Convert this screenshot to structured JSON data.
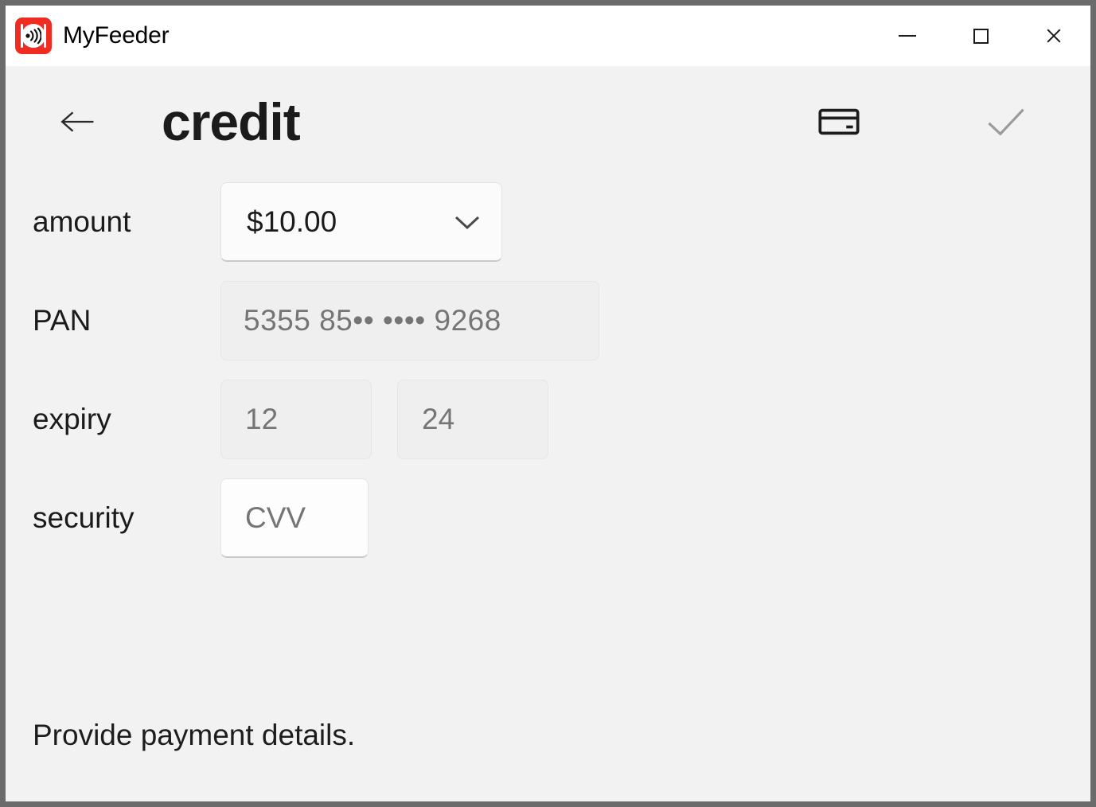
{
  "window": {
    "app_title": "MyFeeder",
    "app_icon": "myfeeder-logo-icon",
    "controls": {
      "minimize_label": "Minimize",
      "maximize_label": "Maximize",
      "close_label": "Close"
    }
  },
  "page": {
    "title": "credit",
    "back_label": "Back",
    "actions": [
      {
        "name": "credit-card-icon",
        "label": "Card"
      },
      {
        "name": "confirm-check-icon",
        "label": "Confirm"
      }
    ]
  },
  "form": {
    "amount": {
      "label": "amount",
      "value": "$10.00",
      "chevron": "chevron-down-icon"
    },
    "pan": {
      "label": "PAN",
      "placeholder": "5355 85•• •••• 9268",
      "value": ""
    },
    "expiry": {
      "label": "expiry",
      "month_placeholder": "12",
      "month_value": "",
      "year_placeholder": "24",
      "year_value": ""
    },
    "security": {
      "label": "security",
      "placeholder": "CVV",
      "value": ""
    }
  },
  "status": {
    "message": "Provide payment details."
  },
  "colors": {
    "brand_red": "#ef2b22",
    "window_border": "#6b6b6b",
    "content_bg": "#f2f2f2",
    "titlebar_bg": "#ffffff",
    "text_primary": "#1b1b1b",
    "text_muted": "#a0a0a0",
    "check_disabled": "#9a9a9a"
  }
}
